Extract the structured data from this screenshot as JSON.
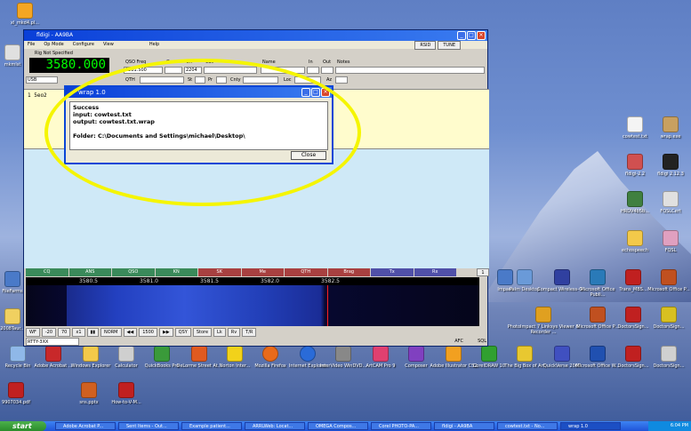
{
  "desktop": {
    "icons": [
      {
        "label": "xl_mkd4.pl..."
      },
      {
        "label": "mkmlst"
      },
      {
        "label": "FileFarms"
      },
      {
        "label": "2008Taur..."
      },
      {
        "label": "Recycle Bin"
      },
      {
        "label": "Adobe Acrobat ..."
      },
      {
        "label": "Windows Explorer"
      },
      {
        "label": "Calculator"
      },
      {
        "label": "QuickBooks Pro"
      },
      {
        "label": "DeLorme Street At..."
      },
      {
        "label": "Norton Inter..."
      },
      {
        "label": "Mozilla Firefox"
      },
      {
        "label": "Internet Explorer"
      },
      {
        "label": "InterVideo WinDVD..."
      },
      {
        "label": "ArtCAM Pro 9"
      },
      {
        "label": "Composer"
      },
      {
        "label": "Adobe Illustrator CS2"
      },
      {
        "label": "CorelDRAW 10"
      },
      {
        "label": "The Big Box of Art"
      },
      {
        "label": "QuickVerse 2007"
      },
      {
        "label": "Microsoft Office W..."
      },
      {
        "label": "DoctorsSign..."
      },
      {
        "label": "DoctorsSign..."
      },
      {
        "label": "Impact"
      },
      {
        "label": "Palm Desktop"
      },
      {
        "label": "Compact Wireless-G..."
      },
      {
        "label": "Microsoft Office Publi..."
      },
      {
        "label": "Trans_MBS..."
      },
      {
        "label": "Microsoft Office P..."
      },
      {
        "label": "PhotoImpact 7 Linksys Viewer & Recorder ..."
      },
      {
        "label": "Microsoft Office P..."
      },
      {
        "label": "DoctorsSign..."
      },
      {
        "label": "DoctorsSign..."
      },
      {
        "label": "cowtest.txt"
      },
      {
        "label": "wrap.exe"
      },
      {
        "label": "fldigi-2.2"
      },
      {
        "label": "fldigi 2.12.3"
      },
      {
        "label": "HRDV4b5b..."
      },
      {
        "label": "FQSLCert"
      },
      {
        "label": "echospeech"
      },
      {
        "label": "FQSL"
      },
      {
        "label": "9907034.pdf"
      },
      {
        "label": "sns.pptx"
      },
      {
        "label": "How-to-V-M..."
      }
    ]
  },
  "main_window": {
    "title": "fldigi - AA9BA",
    "menu": [
      "File",
      "Op Mode",
      "Configure",
      "View",
      "Help"
    ],
    "rsid_button": "RSID",
    "tune_button": "TUNE",
    "rig_label": "Rig Not Specified",
    "frequency": "3580.000",
    "mode_select": "USB",
    "qso_freq_label": "QSO Freq",
    "qso_freq_value": "3581.500",
    "on_label": "On",
    "off_label": "Off",
    "off_value": "2204",
    "call_label": "Call",
    "name_label": "Name",
    "in_label": "In",
    "out_label": "Out",
    "notes_label": "Notes",
    "qth_label": "QTH",
    "st_label": "St",
    "pr_label": "Pr",
    "cnty_label": "Cnty",
    "loc_label": "Loc",
    "az_label": "Az",
    "rx_text": "1  5eo2",
    "macros": [
      "CQ",
      "ANS",
      "QSO",
      "KN",
      "SK",
      "Me",
      "QTH",
      "Brag",
      "Tx",
      "Rx"
    ],
    "macro_page": "1",
    "scale_ticks": [
      "3580.5",
      "3581.0",
      "3581.5",
      "3582.0",
      "3582.5"
    ],
    "controls": [
      "WF",
      "-20",
      "70",
      "x1",
      "NORM",
      "1500",
      "QSY",
      "Store",
      "Lk",
      "Rv",
      "T/R"
    ],
    "status_mode": "RTTY-3XX",
    "afc_label": "AFC",
    "sql_label": "SQL"
  },
  "dialog": {
    "title": "wrap 1.0",
    "lines": [
      "Success",
      "input: cowtest.txt",
      "output: cowtest.txt.wrap",
      "",
      "Folder: C:\\Documents and Settings\\michael\\Desktop\\"
    ],
    "close_button": "Close"
  },
  "taskbar": {
    "start_label": "start",
    "tasks": [
      "Adobe Acrobat P...",
      "Sent Items - Out...",
      "Example patient...",
      "ARRLWeb: Locat...",
      "OMEGA Compos...",
      "Corel PHOTO-PA...",
      "fldigi - AA9BA",
      "cowtest.txt - No...",
      "wrap 1.0"
    ],
    "clock": "6:04 PM"
  },
  "colors": {
    "highlight_ellipse": "#f5f500",
    "rx_pane": "#fffccd",
    "tx_pane": "#cfe9f7"
  }
}
